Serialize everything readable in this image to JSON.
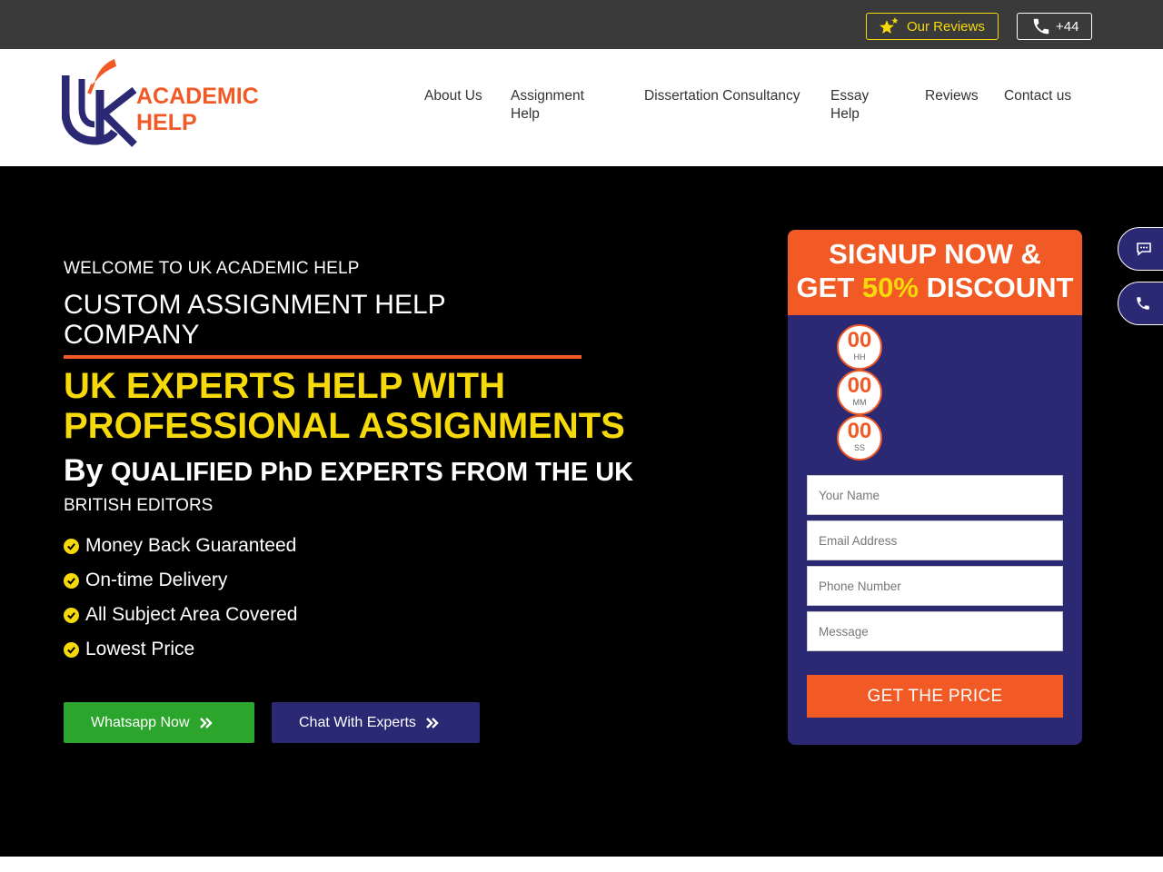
{
  "topbar": {
    "reviews_label": "Our Reviews",
    "phone_label": "+44"
  },
  "nav": {
    "items": [
      "About Us",
      "Assignment Help",
      "Dissertation Consultancy",
      "Essay Help",
      "Reviews",
      "Contact us"
    ]
  },
  "hero": {
    "welcome": "WELCOME TO UK ACADEMIC HELP",
    "heading": "CUSTOM ASSIGNMENT HELP COMPANY",
    "headline": "UK EXPERTS HELP WITH PROFESSIONAL ASSIGNMENTS",
    "by": "By",
    "byline": "QUALIFIED PhD EXPERTS FROM THE UK",
    "subline": "BRITISH EDITORS",
    "features": [
      "Money Back Guaranteed",
      "On-time Delivery",
      "All Subject Area Covered",
      "Lowest Price"
    ],
    "whatsapp_label": "Whatsapp Now",
    "chat_label": "Chat With Experts"
  },
  "form": {
    "title_line1": "SIGNUP NOW &",
    "title_get": "GET",
    "title_pct": "50%",
    "title_discount": "DISCOUNT",
    "timer": [
      {
        "value": "00",
        "label": "HH"
      },
      {
        "value": "00",
        "label": "MM"
      },
      {
        "value": "00",
        "label": "SS"
      }
    ],
    "name_placeholder": "Your Name",
    "email_placeholder": "Email Address",
    "phone_placeholder": "Phone Number",
    "message_placeholder": "Message",
    "submit_label": "GET THE PRICE"
  },
  "colors": {
    "accent_orange": "#f15a24",
    "accent_yellow": "#f5d90a",
    "navy": "#2b2874",
    "green": "#2ba52b"
  },
  "icons": [
    "star-icon",
    "phone-icon",
    "check-circle-icon",
    "double-chevron-right-icon",
    "chat-icon",
    "logo-mark-icon"
  ]
}
